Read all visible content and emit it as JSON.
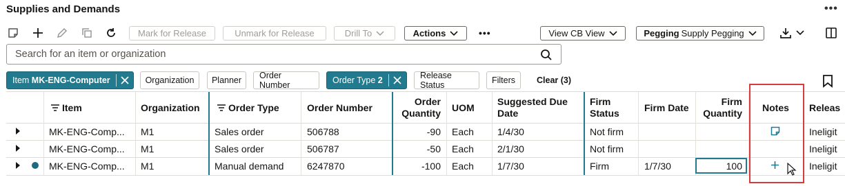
{
  "header": {
    "title": "Supplies and Demands",
    "more": "•••"
  },
  "toolbar": {
    "mark_for_release": "Mark for Release",
    "unmark_for_release": "Unmark for Release",
    "drill_to": "Drill To",
    "actions": "Actions",
    "overflow": "•••",
    "view_cb": "View CB View",
    "pegging_label": "Pegging",
    "pegging_value": "Supply Pegging"
  },
  "search": {
    "placeholder": "Search for an item or organization"
  },
  "filters": {
    "item_label": "Item",
    "item_value": "MK-ENG-Computer",
    "organization": "Organization",
    "planner": "Planner",
    "order_number": "Order Number",
    "order_type_label": "Order Type",
    "order_type_value": "2",
    "release_status": "Release Status",
    "filters": "Filters",
    "clear": "Clear (3)"
  },
  "table": {
    "headers": {
      "item": "Item",
      "organization": "Organization",
      "order_type": "Order Type",
      "order_number": "Order Number",
      "order_quantity_1": "Order",
      "order_quantity_2": "Quantity",
      "uom": "UOM",
      "suggested_due_date_1": "Suggested Due",
      "suggested_due_date_2": "Date",
      "firm_status_1": "Firm",
      "firm_status_2": "Status",
      "firm_date": "Firm Date",
      "firm_quantity_1": "Firm",
      "firm_quantity_2": "Quantity",
      "notes": "Notes",
      "release": "Releas"
    },
    "rows": [
      {
        "item": "MK-ENG-Comp...",
        "organization": "M1",
        "order_type": "Sales order",
        "order_number": "506788",
        "order_quantity": "-90",
        "uom": "Each",
        "due_date": "1/4/30",
        "firm_status": "Not firm",
        "firm_date": "",
        "firm_quantity": "",
        "release": "Ineligit"
      },
      {
        "item": "MK-ENG-Comp...",
        "organization": "M1",
        "order_type": "Sales order",
        "order_number": "506787",
        "order_quantity": "-50",
        "uom": "Each",
        "due_date": "2/1/30",
        "firm_status": "Not firm",
        "firm_date": "",
        "firm_quantity": "",
        "release": "Ineligit"
      },
      {
        "item": "MK-ENG-Comp...",
        "organization": "M1",
        "order_type": "Manual demand",
        "order_number": "6247870",
        "order_quantity": "-100",
        "uom": "Each",
        "due_date": "1/7/30",
        "firm_status": "Firm",
        "firm_date": "1/7/30",
        "firm_quantity": "100",
        "release": "Ineligit"
      }
    ]
  },
  "colors": {
    "accent": "#227a8e",
    "highlight": "#d83b3b"
  }
}
